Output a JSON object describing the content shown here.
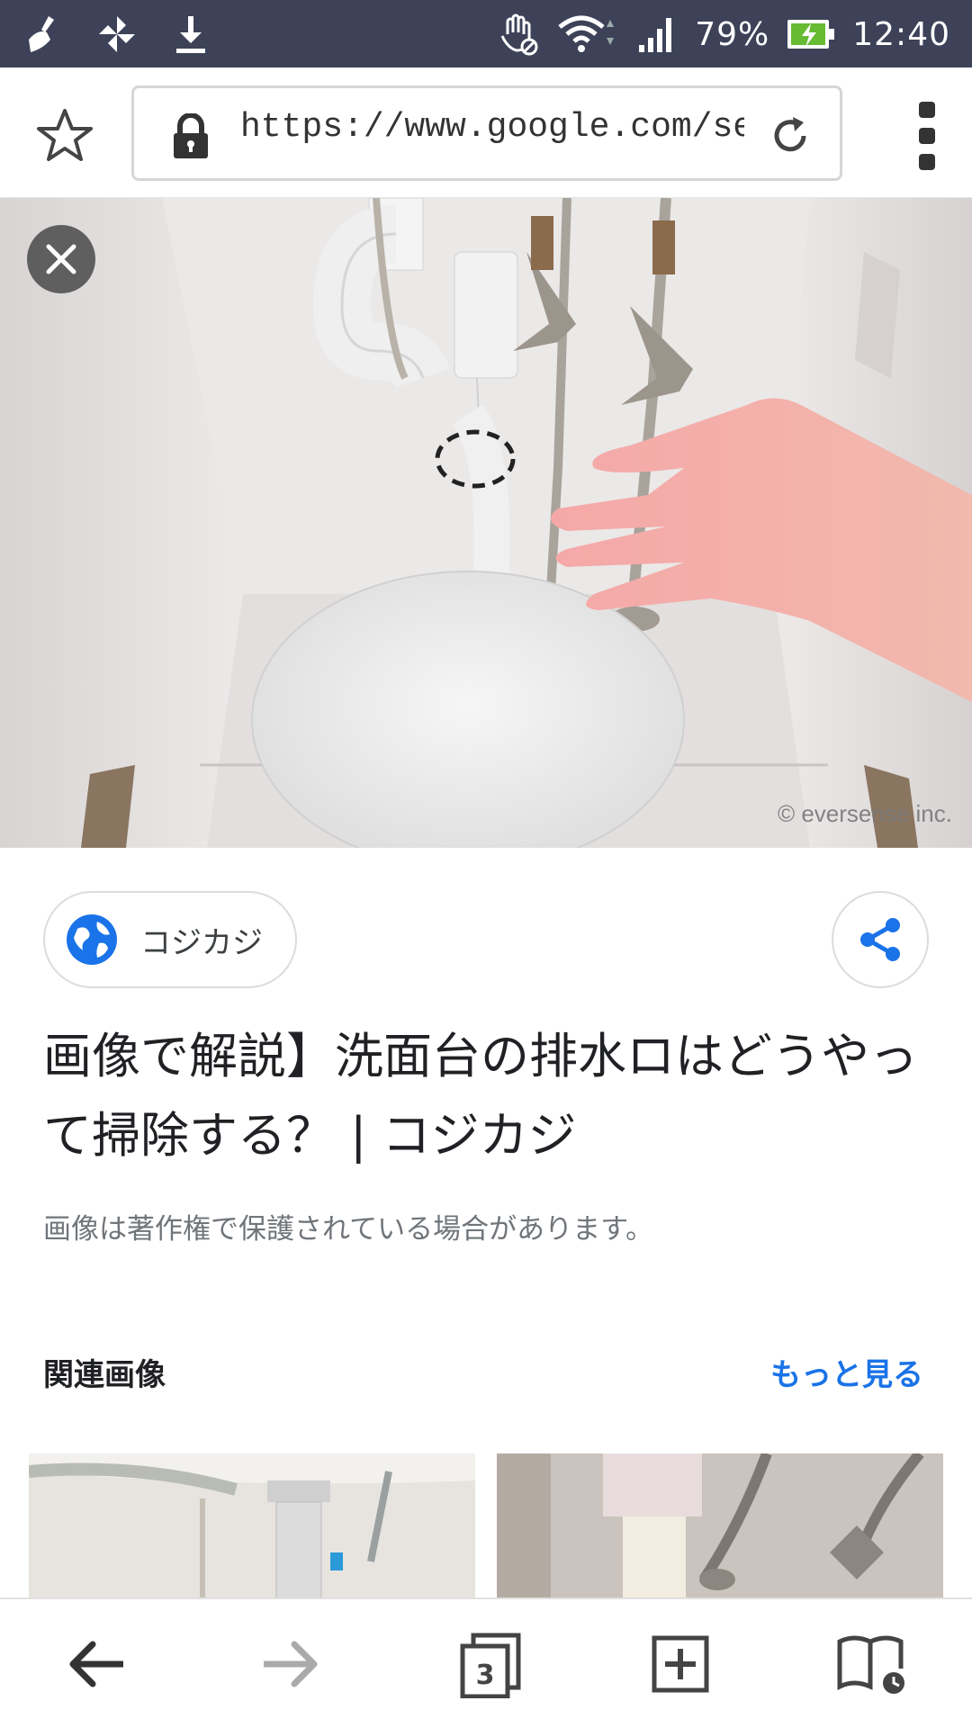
{
  "status_bar": {
    "battery_percent": "79%",
    "time": "12:40",
    "icons": [
      "broom-icon",
      "pinwheel-icon",
      "download-icon",
      "no-touch-hand-icon",
      "wifi-icon",
      "signal-icon",
      "battery-charging-icon"
    ]
  },
  "browser": {
    "url": "https://www.google.com/sear",
    "tab_count": "3"
  },
  "hero_image": {
    "watermark": "© eversense inc."
  },
  "result": {
    "source_name": "コジカジ",
    "title": "画像で解説】洗面台の排水ロはどうやって掃除する？ | コジカジ",
    "copyright_note": "画像は著作権で保護されている場合があります。"
  },
  "related": {
    "heading": "関連画像",
    "more_label": "もっと見る"
  },
  "colors": {
    "status_bar_bg": "#3d4258",
    "link_blue": "#1a73e8",
    "globe_blue": "#1a73e8"
  }
}
